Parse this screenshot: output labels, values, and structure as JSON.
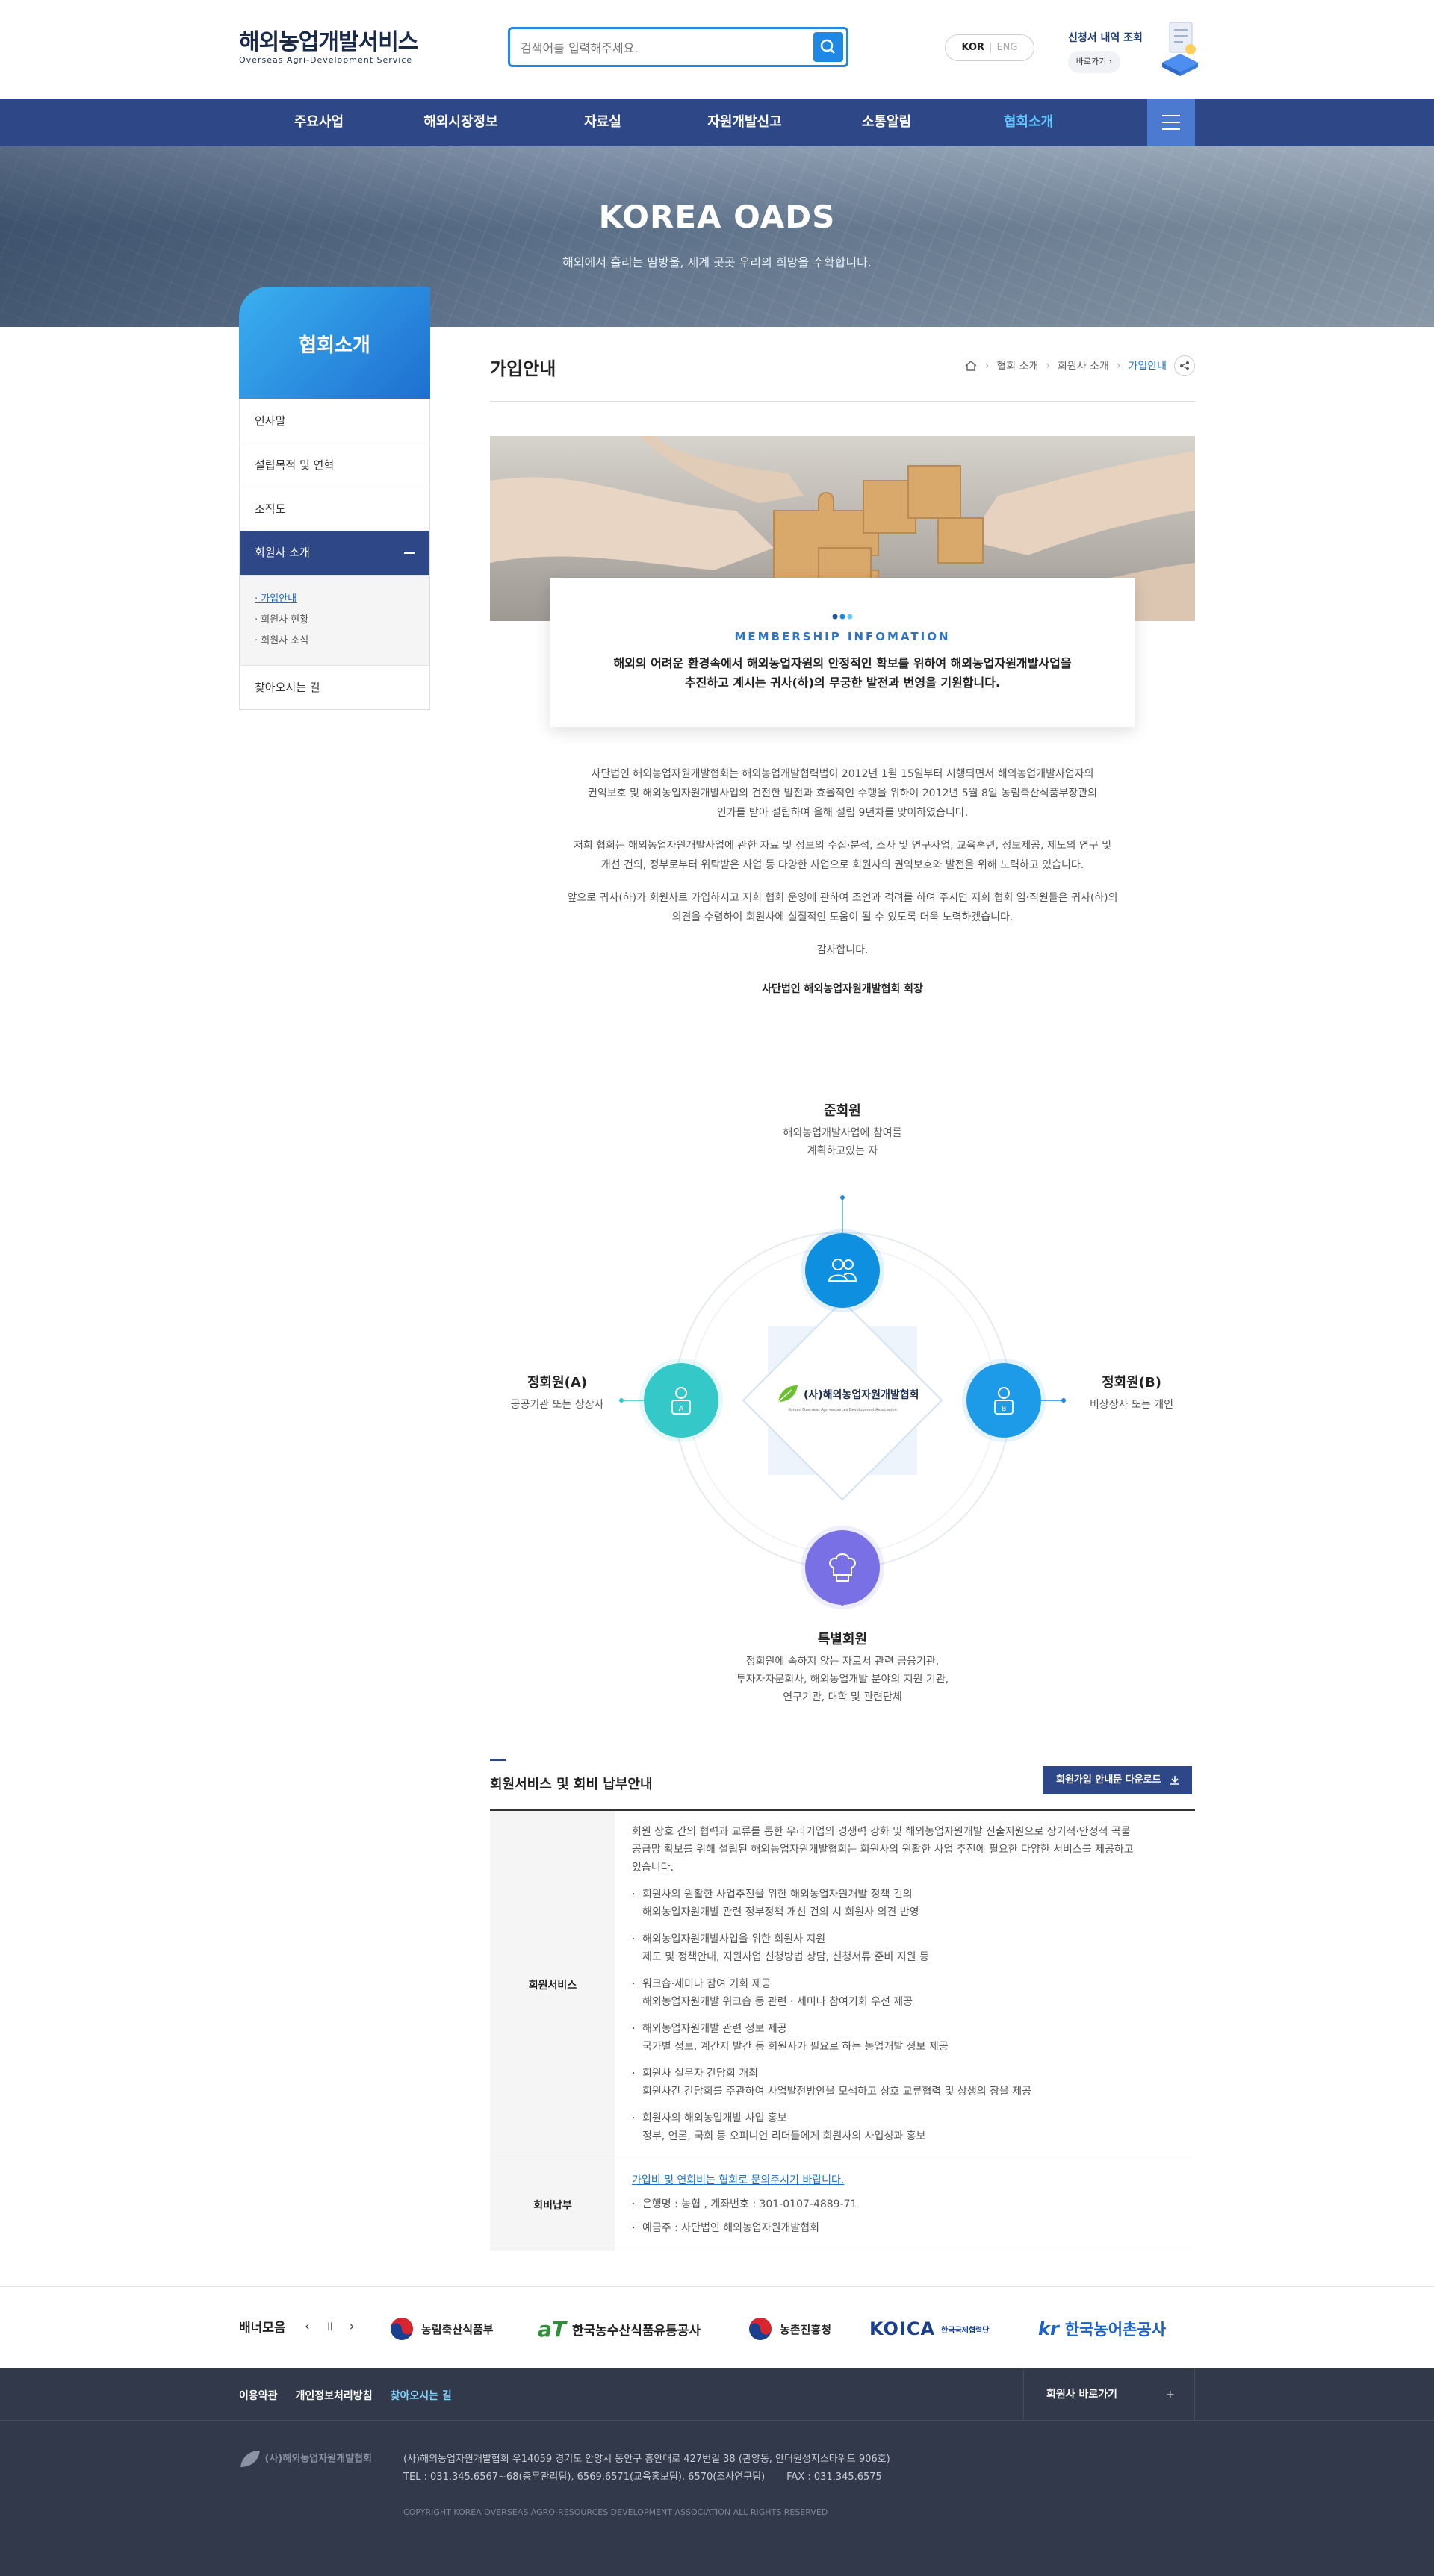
{
  "header": {
    "logo_main": "해외농업개발서비스",
    "logo_sub": "Overseas Agri-Development Service",
    "search_placeholder": "검색어를 입력해주세요.",
    "lang_kor": "KOR",
    "lang_eng": "ENG",
    "apply_title": "신청서 내역 조회",
    "apply_button": "바로가기"
  },
  "gnb": {
    "items": [
      "주요사업",
      "해외시장정보",
      "자료실",
      "자원개발신고",
      "소통알림",
      "협회소개"
    ],
    "active_index": 5
  },
  "visual": {
    "title": "KOREA OADS",
    "subtitle": "해외에서 흘리는 땀방울, 세계 곳곳 우리의 희망을 수확합니다."
  },
  "lnb": {
    "title": "협회소개",
    "items": [
      "인사말",
      "설립목적 및 연혁",
      "조직도",
      "회원사 소개",
      "찾아오시는 길"
    ],
    "sub_items": [
      "가입안내",
      "회원사 현황",
      "회원사 소식"
    ]
  },
  "page": {
    "title": "가입안내",
    "breadcrumb": [
      "협회 소개",
      "회원사 소개",
      "가입안내"
    ]
  },
  "membership": {
    "label": "MEMBERSHIP INFOMATION",
    "headline1": "해외의 어려운 환경속에서 해외농업자원의 안정적인 확보를 위하여 해외농업자원개발사업을",
    "headline2": "추진하고 계시는 귀사(하)의 무궁한 발전과 번영을 기원합니다.",
    "para1a": "사단법인 해외농업자원개발협회는 해외농업개발협력법이 2012년 1월 15일부터 시행되면서 해외농업개발사업자의",
    "para1b": "권익보호 및 해외농업자원개발사업의 건전한 발전과 효율적인 수행을 위하여 2012년 5월 8일 농림축산식품부장관의",
    "para1c": "인가를 받아 설립하여 올해 설립 9년차를 맞이하였습니다.",
    "para2a": "저희 협회는 해외농업자원개발사업에 관한 자료 및 정보의 수집·분석, 조사 및 연구사업, 교육훈련, 정보제공, 제도의 연구 및",
    "para2b": "개선 건의, 정부로부터 위탁받은 사업 등 다양한 사업으로 회원사의 권익보호와 발전을 위해 노력하고 있습니다.",
    "para3a": "앞으로 귀사(하)가 회원사로 가입하시고 저희 협회 운영에 관하여 조언과 격려를 하여 주시면 저희 협회 임·직원들은 귀사(하)의",
    "para3b": "의견을 수렴하여 회원사에 실질적인 도움이 될 수 있도록 더욱 노력하겠습니다.",
    "thanks": "감사합니다.",
    "sign": "사단법인 해외농업자원개발협회 회장"
  },
  "members": {
    "center": "(사)해외농업자원개발협회",
    "center_sub": "Korean Overseas Agri-resources Development Association",
    "top": {
      "name": "준회원",
      "desc1": "해외농업개발사업에 참여를",
      "desc2": "계획하고있는 자"
    },
    "left": {
      "name": "정회원(A)",
      "desc1": "공공기관 또는 상장사",
      "badge": "A"
    },
    "right": {
      "name": "정회원(B)",
      "desc1": "비상장사 또는 개인",
      "badge": "B"
    },
    "bottom": {
      "name": "특별회원",
      "desc1": "정회원에 속하지 않는 자로서 관련 금융기관,",
      "desc2": "투자자자문회사, 해외농업개발 분야의 지원 기관,",
      "desc3": "연구기관, 대학 및 관련단체"
    }
  },
  "service": {
    "title": "회원서비스 및 회비 납부안내",
    "download": "회원가입 안내문 다운로드",
    "row1_head": "회원서비스",
    "row1_intro1": "회원 상호 간의 협력과 교류를 통한 우리기업의 경쟁력 강화 및 해외농업자원개발 진출지원으로 장기적·안정적 곡물",
    "row1_intro2": "공급망 확보를 위해 설립된 해외농업자원개발협회는 회원사의 원활한 사업 추진에 필요한 다양한 서비스를 제공하고",
    "row1_intro3": "있습니다.",
    "items": [
      {
        "a": "회원사의 원활한 사업추진을 위한 해외농업자원개발 정책 건의",
        "b": "해외농업자원개발 관련 정부정책 개선 건의 시 회원사 의견 반영"
      },
      {
        "a": "해외농업자원개발사업을 위한 회원사 지원",
        "b": "제도 및 정책안내, 지원사업 신청방법 상담, 신청서류 준비 지원 등"
      },
      {
        "a": "워크숍·세미나 참여 기회 제공",
        "b": "해외농업자원개발 워크숍 등 관련 · 세미나 참여기회 우선 제공"
      },
      {
        "a": "해외농업자원개발 관련 정보 제공",
        "b": "국가별 정보, 계간지 발간 등 회원사가 필요로 하는 농업개발 정보 제공"
      },
      {
        "a": "회원사 실무자 간담회 개최",
        "b": "회원사간 간담회를 주관하여 사업발전방안을 모색하고 상호 교류협력 및 상생의 장을 제공"
      },
      {
        "a": "회원사의 해외농업개발 사업 홍보",
        "b": "정부, 언론, 국회 등 오피니언 리더들에게 회원사의 사업성과 홍보"
      }
    ],
    "row2_head": "회비납부",
    "row2_link": "가입비 및 연회비는 협회로 문의주시기 바랍니다.",
    "row2_bank": "은행명 : 농협 , 계좌번호 : 301-0107-4889-71",
    "row2_holder": "예금주 : 사단법인 해외농업자원개발협회"
  },
  "banner": {
    "title": "배너모음",
    "controls": "‹ ॥ ›",
    "items": [
      "농림축산식품부",
      "aT",
      "한국농수산식품유통공사",
      "농촌진흥청",
      "KOICA",
      "한국국제협력단",
      "kr",
      "한국농어촌공사"
    ]
  },
  "footer": {
    "links": [
      "이용약관",
      "개인정보처리방침",
      "찾아오시는 길"
    ],
    "family": "회원사 바로가기",
    "plus": "+",
    "logo": "(사)해외농업자원개발협회",
    "addr1": "(사)해외농업자원개발협회 우14059 경기도 안양시 동안구 흥안대로 427번길 38 (관양동, 안더원성지스타위드 906호)",
    "addr2": "TEL : 031.345.6567~68(총무관리팀), 6569,6571(교육홍보팀), 6570(조사연구팀)       FAX : 031.345.6575",
    "copy": "COPYRIGHT KOREA OVERSEAS AGRO-RESOURCES DEVELOPMENT ASSOCIATION ALL RIGHTS RESERVED"
  },
  "colors": {
    "navy": "#2e4787",
    "accent_blue": "#1e88e5",
    "teal": "#35c8c9",
    "member_blue": "#0f8fe0",
    "purple": "#7a70e6"
  }
}
